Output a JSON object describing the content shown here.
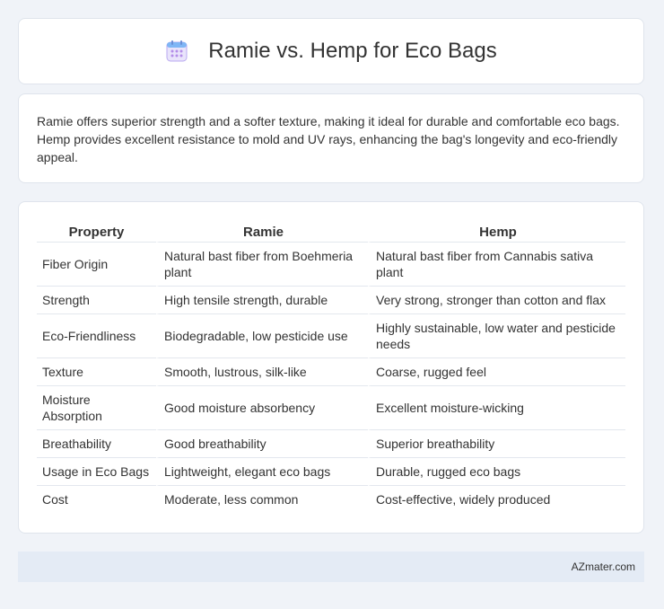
{
  "header": {
    "title": "Ramie vs. Hemp for Eco Bags",
    "icon": "calendar-icon"
  },
  "summary": {
    "text": "Ramie offers superior strength and a softer texture, making it ideal for durable and comfortable eco bags. Hemp provides excellent resistance to mold and UV rays, enhancing the bag's longevity and eco-friendly appeal."
  },
  "table": {
    "columns": [
      "Property",
      "Ramie",
      "Hemp"
    ],
    "rows": [
      [
        "Fiber Origin",
        "Natural bast fiber from Boehmeria plant",
        "Natural bast fiber from Cannabis sativa plant"
      ],
      [
        "Strength",
        "High tensile strength, durable",
        "Very strong, stronger than cotton and flax"
      ],
      [
        "Eco-Friendliness",
        "Biodegradable, low pesticide use",
        "Highly sustainable, low water and pesticide needs"
      ],
      [
        "Texture",
        "Smooth, lustrous, silk-like",
        "Coarse, rugged feel"
      ],
      [
        "Moisture Absorption",
        "Good moisture absorbency",
        "Excellent moisture-wicking"
      ],
      [
        "Breathability",
        "Good breathability",
        "Superior breathability"
      ],
      [
        "Usage in Eco Bags",
        "Lightweight, elegant eco bags",
        "Durable, rugged eco bags"
      ],
      [
        "Cost",
        "Moderate, less common",
        "Cost-effective, widely produced"
      ]
    ]
  },
  "footer": {
    "text": "AZmater.com"
  }
}
